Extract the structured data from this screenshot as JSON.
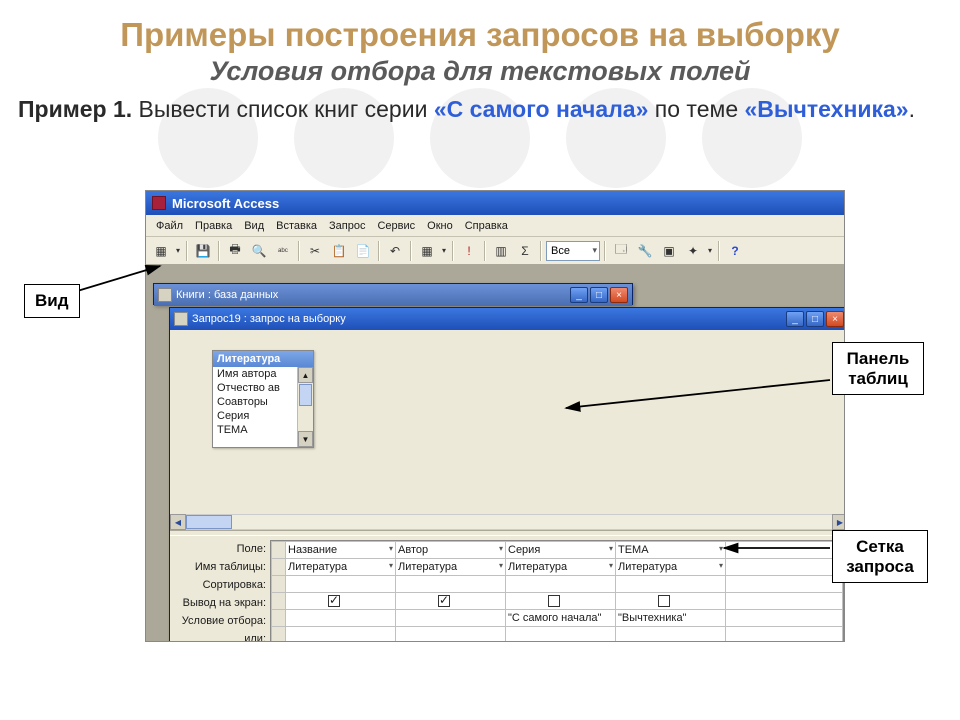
{
  "slide": {
    "title": "Примеры построения запросов на выборку",
    "subtitle": "Условия отбора для текстовых полей",
    "example_label": "Пример 1.",
    "example_text_1": " Вывести список книг серии ",
    "example_q1": "«С самого начала»",
    "example_text_2": " по теме ",
    "example_q2": "«Вычтехника»",
    "example_dot": "."
  },
  "callouts": {
    "view": "Вид",
    "tables_panel_l1": "Панель",
    "tables_panel_l2": "таблиц",
    "grid_l1": "Сетка",
    "grid_l2": "запроса"
  },
  "access": {
    "app_title": "Microsoft Access",
    "menu": [
      "Файл",
      "Правка",
      "Вид",
      "Вставка",
      "Запрос",
      "Сервис",
      "Окно",
      "Справка"
    ],
    "combo_all": "Все",
    "dim_title": "Книги : база данных",
    "query_title": "Запрос19 : запрос на выборку",
    "table_card_title": "Литература",
    "table_fields": [
      "Имя автора",
      "Отчество ав",
      "Соавторы",
      "Серия",
      "ТЕМА"
    ],
    "row_labels": [
      "Поле:",
      "Имя таблицы:",
      "Сортировка:",
      "Вывод на экран:",
      "Условие отбора:",
      "или:"
    ],
    "columns": [
      {
        "field": "Название",
        "table": "Литература",
        "show": true,
        "criteria": ""
      },
      {
        "field": "Автор",
        "table": "Литература",
        "show": true,
        "criteria": ""
      },
      {
        "field": "Серия",
        "table": "Литература",
        "show": false,
        "criteria": "\"С самого начала\""
      },
      {
        "field": "ТЕМА",
        "table": "Литература",
        "show": false,
        "criteria": "\"Вычтехника\""
      }
    ]
  }
}
